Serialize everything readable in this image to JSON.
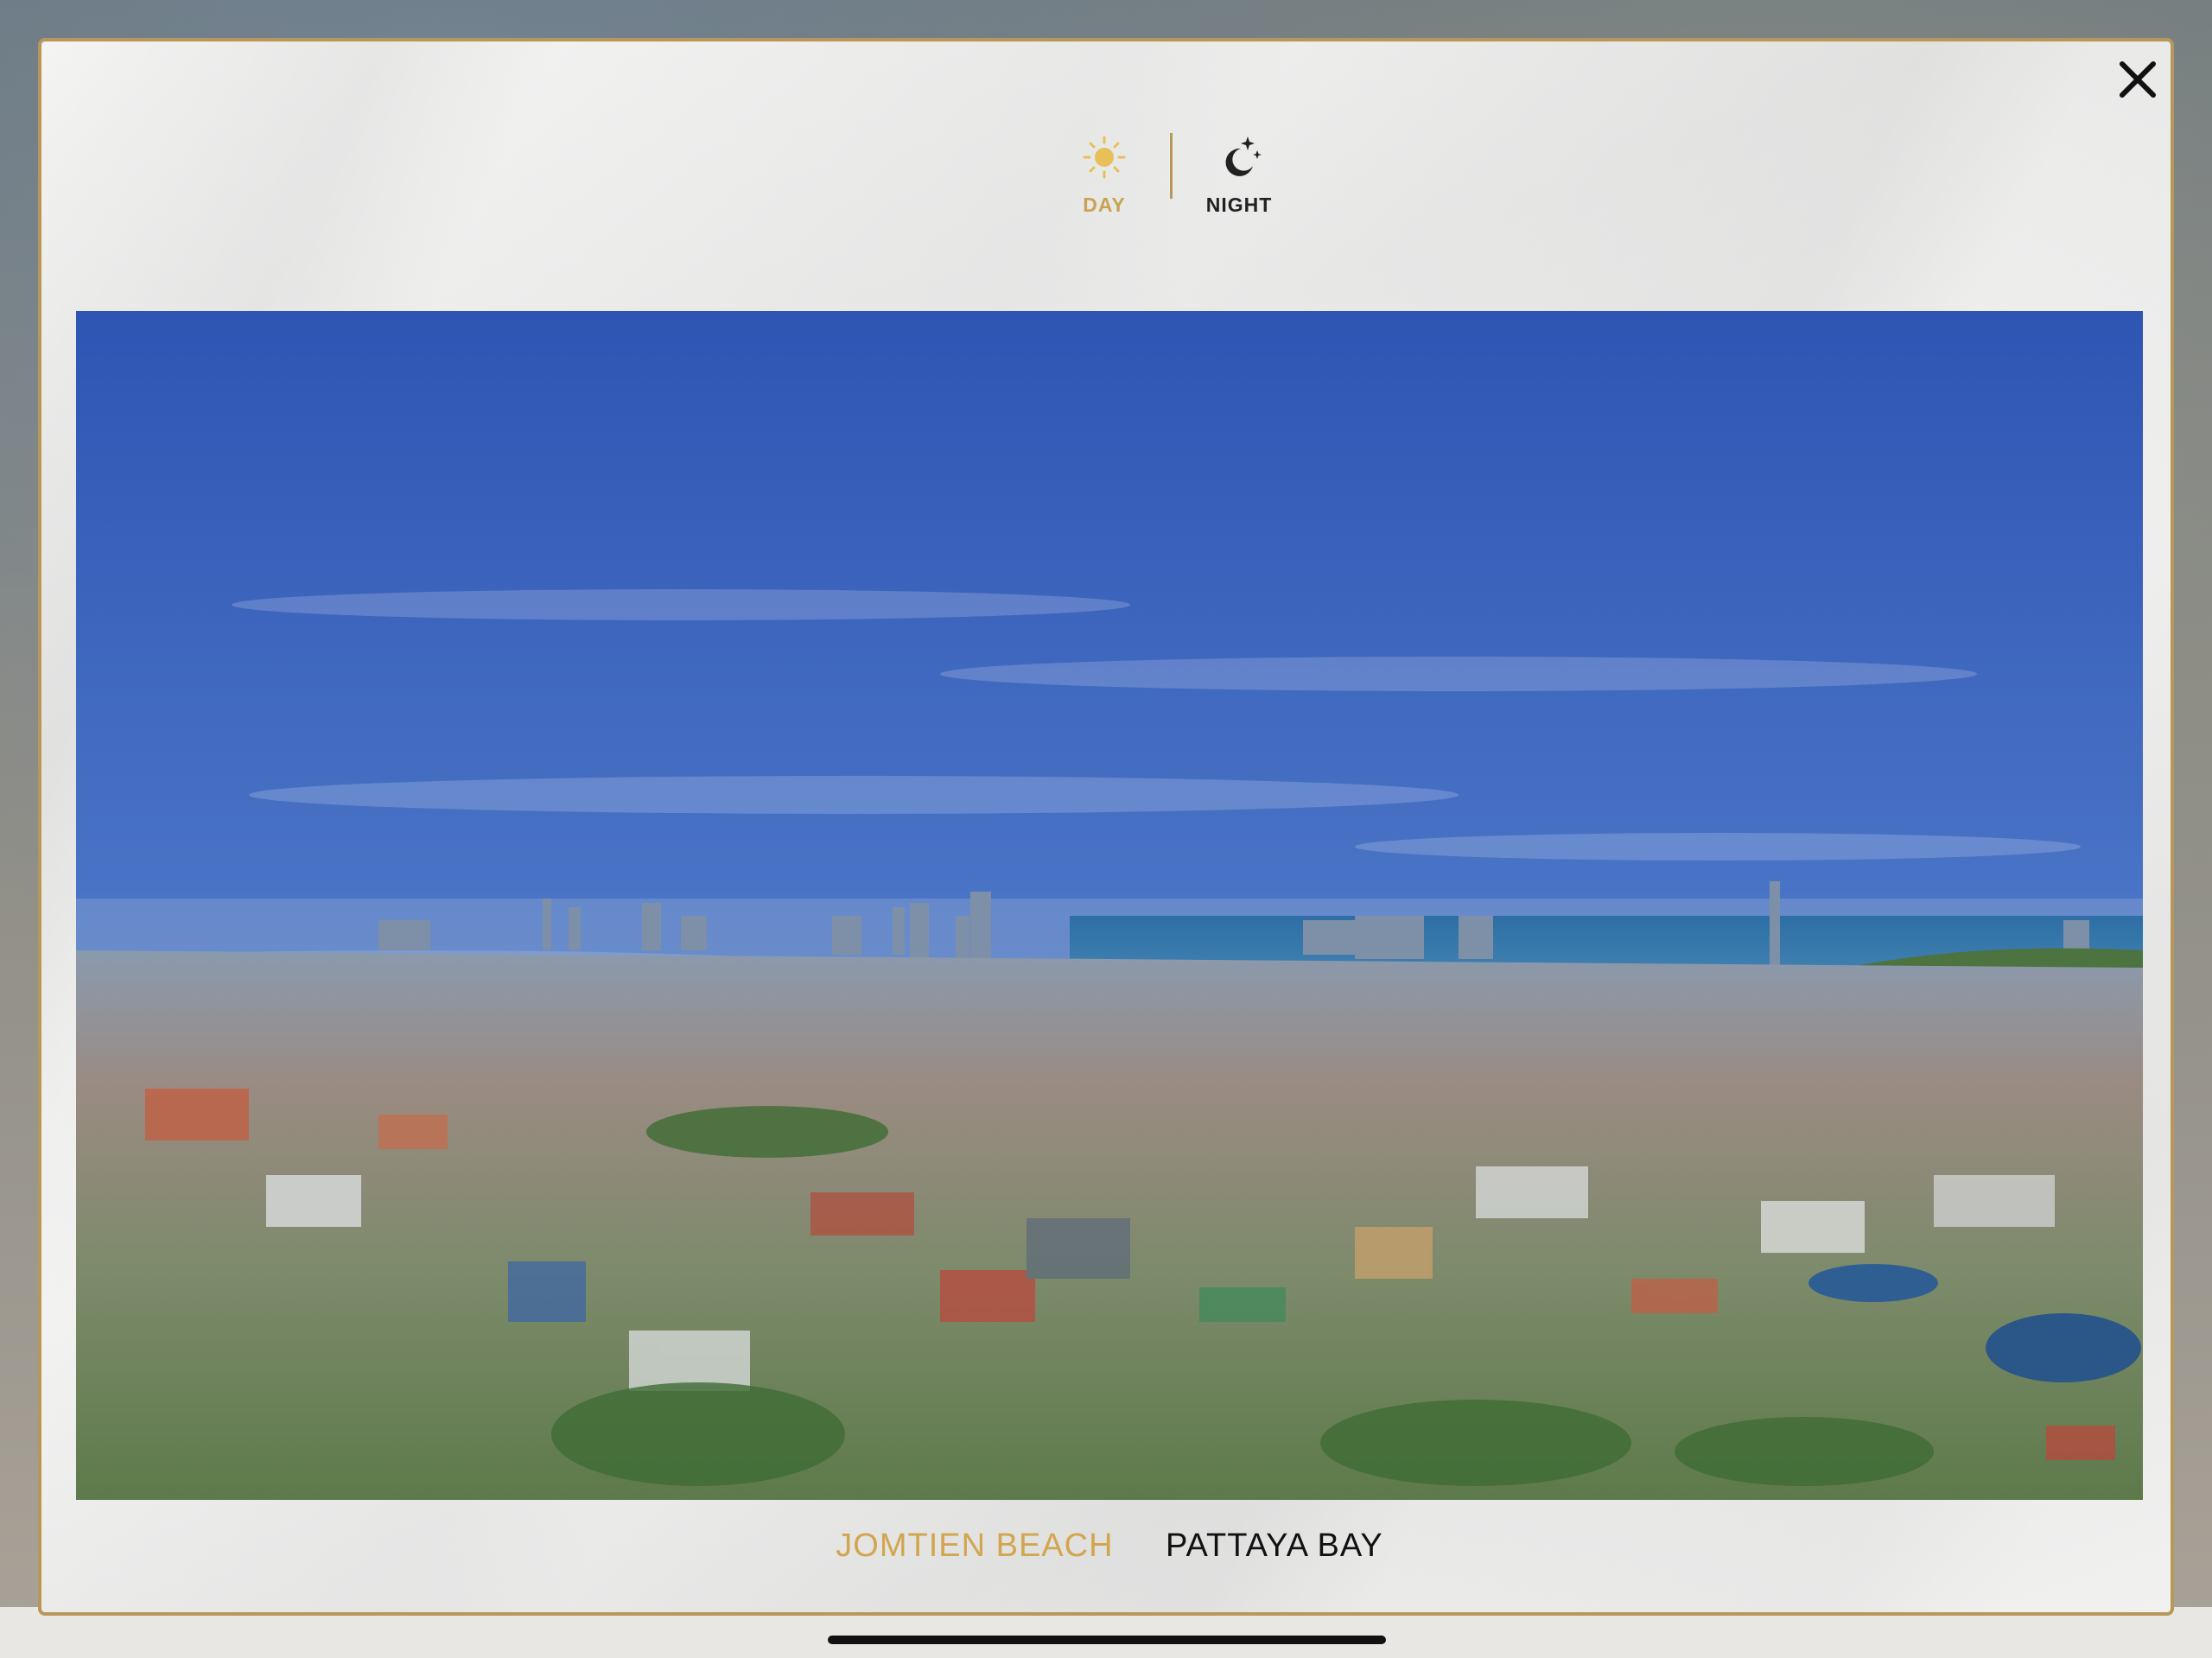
{
  "toggle": {
    "day_label": "DAY",
    "night_label": "NIGHT",
    "active": "day"
  },
  "locations": {
    "tabs": [
      {
        "label": "JOMTIEN BEACH",
        "active": true
      },
      {
        "label": "PATTAYA BAY",
        "active": false
      }
    ]
  },
  "colors": {
    "accent_gold": "#c9a353",
    "frame_gold": "#b7985a",
    "text_dark": "#111111"
  },
  "icons": {
    "close": "close-icon",
    "day": "sun-icon",
    "night": "moon-stars-icon"
  }
}
